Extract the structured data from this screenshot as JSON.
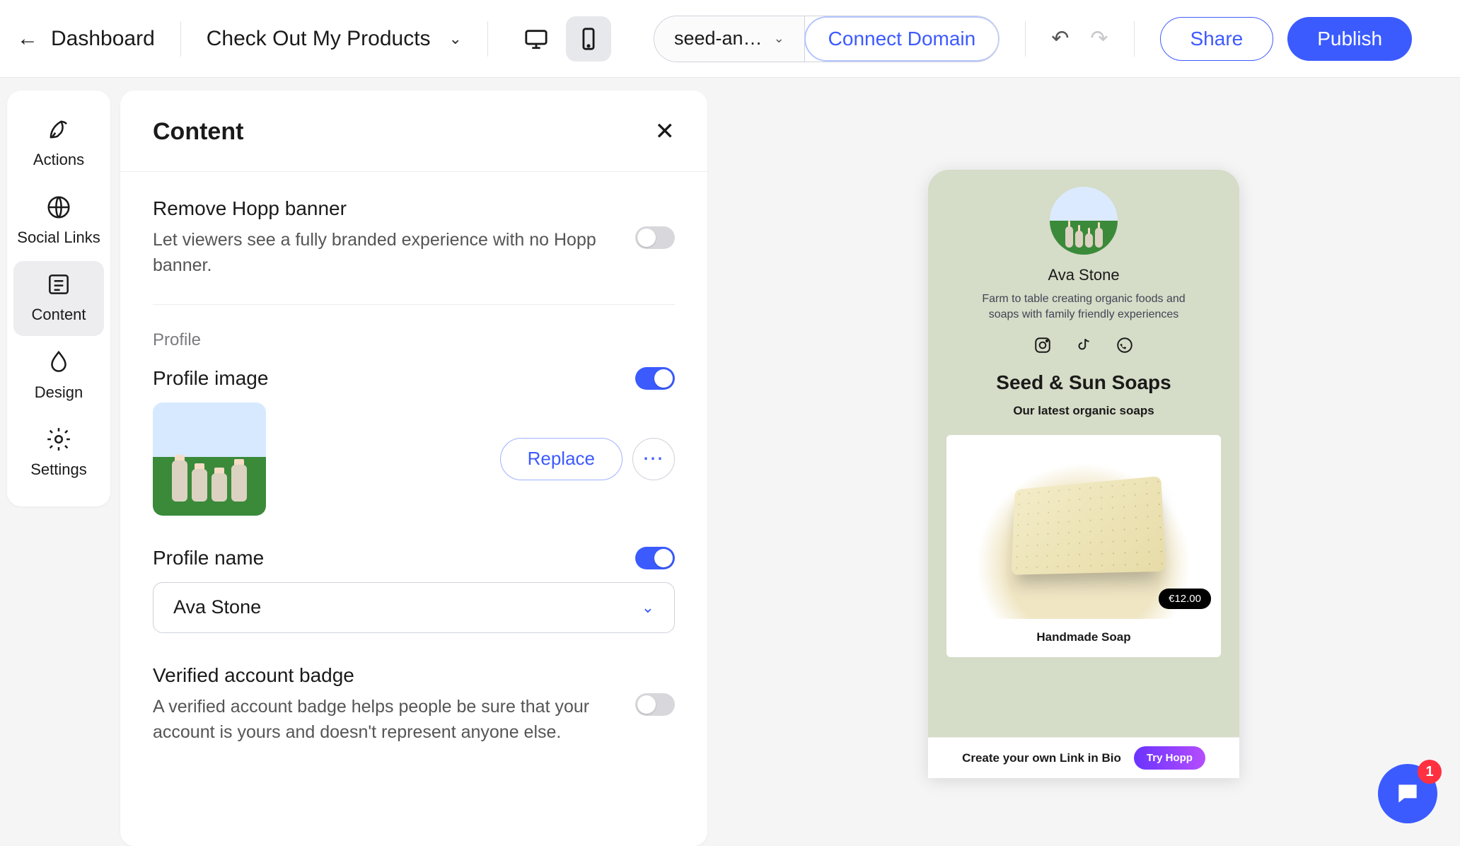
{
  "topbar": {
    "back_label": "Dashboard",
    "site_name": "Check Out My Products",
    "domain_preview": "seed-an…",
    "connect_domain": "Connect Domain",
    "share": "Share",
    "publish": "Publish"
  },
  "rail": {
    "items": [
      {
        "id": "actions",
        "label": "Actions"
      },
      {
        "id": "social",
        "label": "Social Links"
      },
      {
        "id": "content",
        "label": "Content"
      },
      {
        "id": "design",
        "label": "Design"
      },
      {
        "id": "settings",
        "label": "Settings"
      }
    ],
    "active": "content"
  },
  "panel": {
    "title": "Content",
    "remove_banner": {
      "title": "Remove Hopp banner",
      "desc": "Let viewers see a fully branded experience with no Hopp banner.",
      "on": false
    },
    "profile_section_label": "Profile",
    "profile_image": {
      "title": "Profile image",
      "on": true,
      "replace": "Replace"
    },
    "profile_name": {
      "title": "Profile name",
      "on": true,
      "value": "Ava Stone"
    },
    "verified": {
      "title": "Verified account badge",
      "desc": "A verified account badge helps people be sure that your account is yours and doesn't represent anyone else.",
      "on": false
    }
  },
  "preview": {
    "name": "Ava Stone",
    "tagline": "Farm to table creating organic foods and soaps with family friendly experiences",
    "heading": "Seed & Sun Soaps",
    "subheading": "Our latest organic soaps",
    "price": "€12.00",
    "caption": "Handmade Soap",
    "hopp_text": "Create your own Link in Bio",
    "hopp_cta": "Try Hopp"
  },
  "intercom": {
    "count": "1"
  }
}
